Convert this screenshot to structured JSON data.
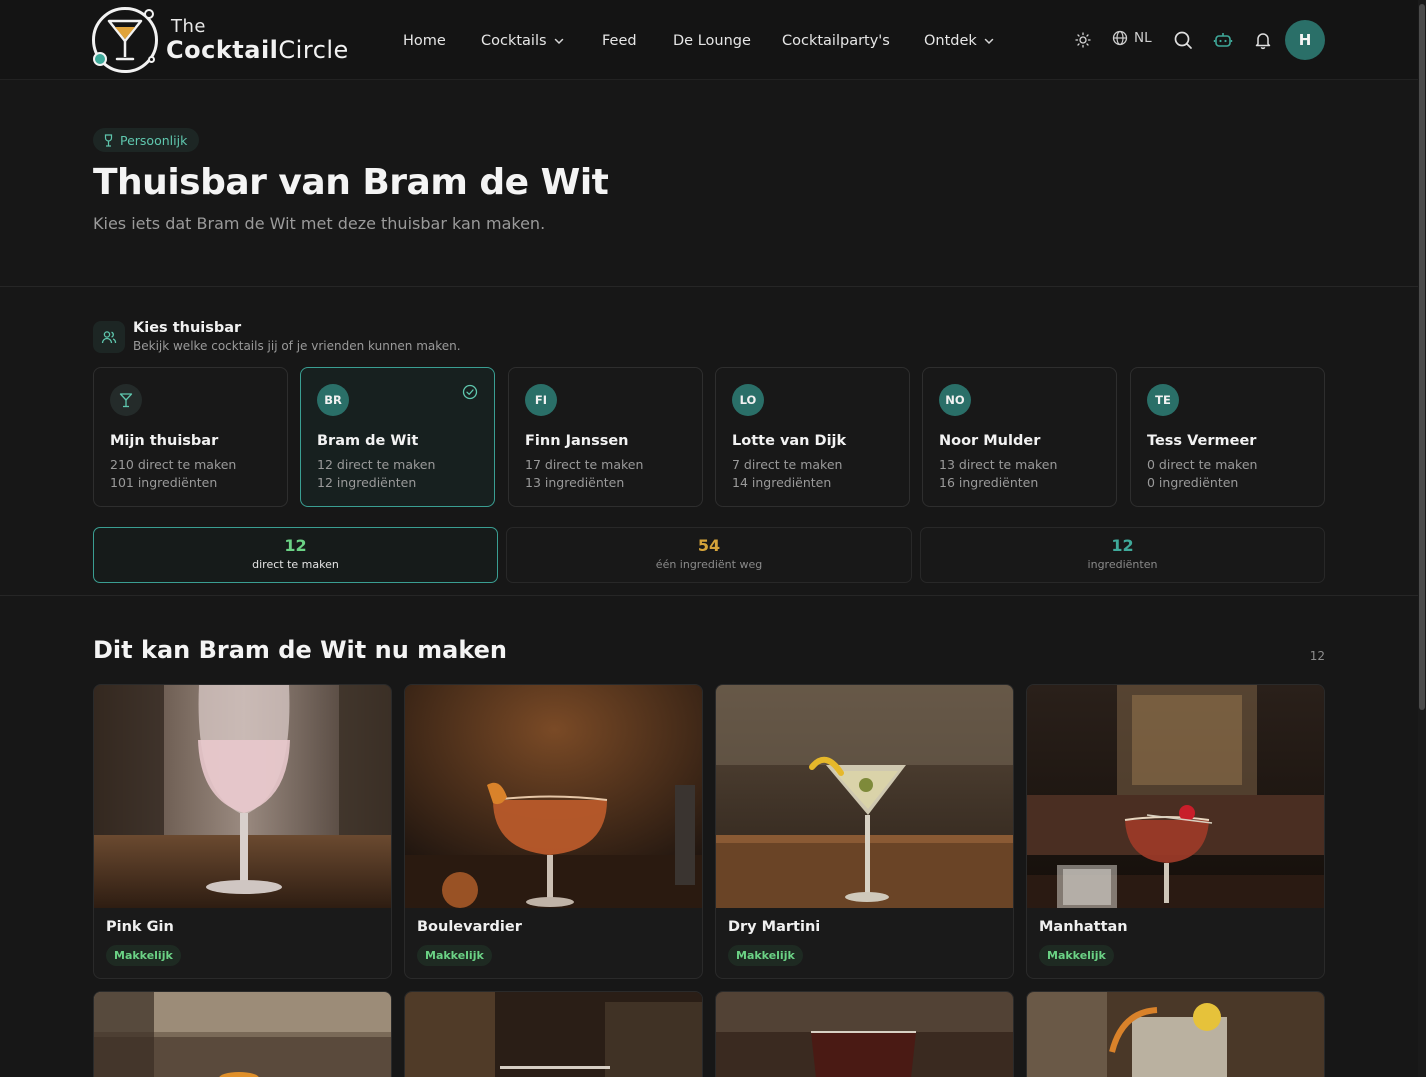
{
  "header": {
    "logo_the": "The",
    "logo_name_bold": "Cocktail",
    "logo_name_rest": "Circle",
    "nav": {
      "home": "Home",
      "cocktails": "Cocktails",
      "feed": "Feed",
      "lounge": "De Lounge",
      "party": "Cocktailparty's",
      "ontdek": "Ontdek"
    },
    "language": "NL",
    "user_initial": "H",
    "icons": [
      "sun-icon",
      "globe-icon",
      "search-icon",
      "robot-icon",
      "bell-icon",
      "chevron-down-icon"
    ]
  },
  "hero": {
    "badge": "Persoonlijk",
    "title": "Thuisbar van Bram de Wit",
    "subtitle": "Kies iets dat Bram de Wit met deze thuisbar kan maken."
  },
  "chooser": {
    "title": "Kies thuisbar",
    "subtitle": "Bekijk welke cocktails jij of je vrienden kunnen maken.",
    "bars": [
      {
        "initials": "",
        "name": "Mijn thuisbar",
        "line1": "210 direct te maken",
        "line2": "101 ingrediënten",
        "selected": false
      },
      {
        "initials": "BR",
        "name": "Bram de Wit",
        "line1": "12 direct te maken",
        "line2": "12 ingrediënten",
        "selected": true
      },
      {
        "initials": "FI",
        "name": "Finn Janssen",
        "line1": "17 direct te maken",
        "line2": "13 ingrediënten",
        "selected": false
      },
      {
        "initials": "LO",
        "name": "Lotte van Dijk",
        "line1": "7 direct te maken",
        "line2": "14 ingrediënten",
        "selected": false
      },
      {
        "initials": "NO",
        "name": "Noor Mulder",
        "line1": "13 direct te maken",
        "line2": "16 ingrediënten",
        "selected": false
      },
      {
        "initials": "TE",
        "name": "Tess Vermeer",
        "line1": "0 direct te maken",
        "line2": "0 ingrediënten",
        "selected": false
      }
    ]
  },
  "stats": [
    {
      "value": "12",
      "label": "direct te maken",
      "color": "#6bd285",
      "active": true
    },
    {
      "value": "54",
      "label": "één ingrediënt weg",
      "color": "#d4a33a",
      "active": false
    },
    {
      "value": "12",
      "label": "ingrediënten",
      "color": "#3fa99a",
      "active": false
    }
  ],
  "section": {
    "title": "Dit kan Bram de Wit nu maken",
    "count": "12"
  },
  "cocktails": [
    {
      "name": "Pink Gin",
      "difficulty": "Makkelijk"
    },
    {
      "name": "Boulevardier",
      "difficulty": "Makkelijk"
    },
    {
      "name": "Dry Martini",
      "difficulty": "Makkelijk"
    },
    {
      "name": "Manhattan",
      "difficulty": "Makkelijk"
    }
  ],
  "colors": {
    "accent": "#3a9e92",
    "background": "#171717",
    "easy_badge": "#6bd285"
  }
}
